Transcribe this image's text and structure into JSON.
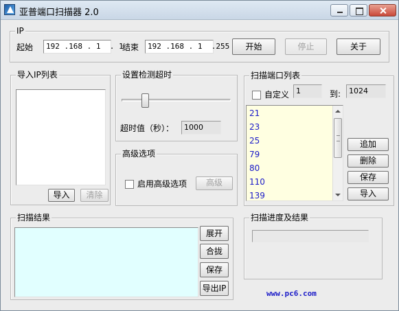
{
  "window": {
    "title": "亚普端口扫描器 2.0"
  },
  "ip": {
    "group_title": "IP",
    "start_label": "起始",
    "start_value": "192 .168 . 1  . 1",
    "end_label": "结束",
    "end_value": "192 .168 . 1  .255",
    "start_button": "开始",
    "stop_button": "停止",
    "about_button": "关于"
  },
  "import": {
    "group_title": "导入IP列表",
    "import_button": "导入",
    "clear_button": "清除"
  },
  "timeout": {
    "group_title": "设置检测超时",
    "label": "超时值（秒）：",
    "value": "1000",
    "slider_level": 0.22
  },
  "advanced": {
    "group_title": "高级选项",
    "checkbox_label": "启用高级选项",
    "button": "高级"
  },
  "ports": {
    "group_title": "扫描端口列表",
    "custom_label": "自定义",
    "from_value": "1",
    "to_label": "到:",
    "to_value": "1024",
    "items": [
      "21",
      "23",
      "25",
      "79",
      "80",
      "110",
      "139"
    ],
    "add_button": "追加",
    "delete_button": "删除",
    "save_button": "保存",
    "import_button": "导入"
  },
  "results": {
    "group_title": "扫描结果",
    "expand_button": "展开",
    "collapse_button": "合拢",
    "save_button": "保存",
    "export_button": "导出IP"
  },
  "progress": {
    "group_title": "扫描进度及结果",
    "value": 0
  },
  "footer": {
    "link": "www.pc6.com"
  }
}
